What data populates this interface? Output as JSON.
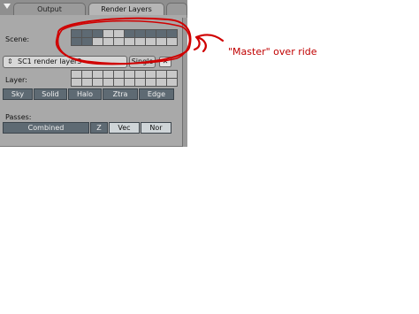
{
  "tabs": {
    "output": "Output",
    "render_layers": "Render Layers"
  },
  "scene": {
    "label": "Scene:",
    "group1_on": [
      1,
      1,
      1,
      0,
      0,
      1,
      1,
      0,
      0,
      0
    ],
    "group2_on": [
      1,
      1,
      1,
      1,
      1,
      0,
      0,
      0,
      0,
      0
    ]
  },
  "render_layer": {
    "value": "SC1 render layer3",
    "single_label": "Single",
    "close_label": "✕"
  },
  "layer": {
    "label": "Layer:",
    "group1_on": [
      0,
      0,
      0,
      0,
      0,
      0,
      0,
      0,
      0,
      0
    ],
    "group2_on": [
      0,
      0,
      0,
      0,
      0,
      0,
      0,
      0,
      0,
      0
    ],
    "options": [
      "Sky",
      "Solid",
      "Halo",
      "Ztra",
      "Edge"
    ]
  },
  "passes": {
    "label": "Passes:",
    "items": [
      "Combined",
      "Z",
      "Vec",
      "Nor"
    ]
  },
  "annotation": {
    "text": "\"Master\" over ride",
    "color": "#c00000"
  }
}
